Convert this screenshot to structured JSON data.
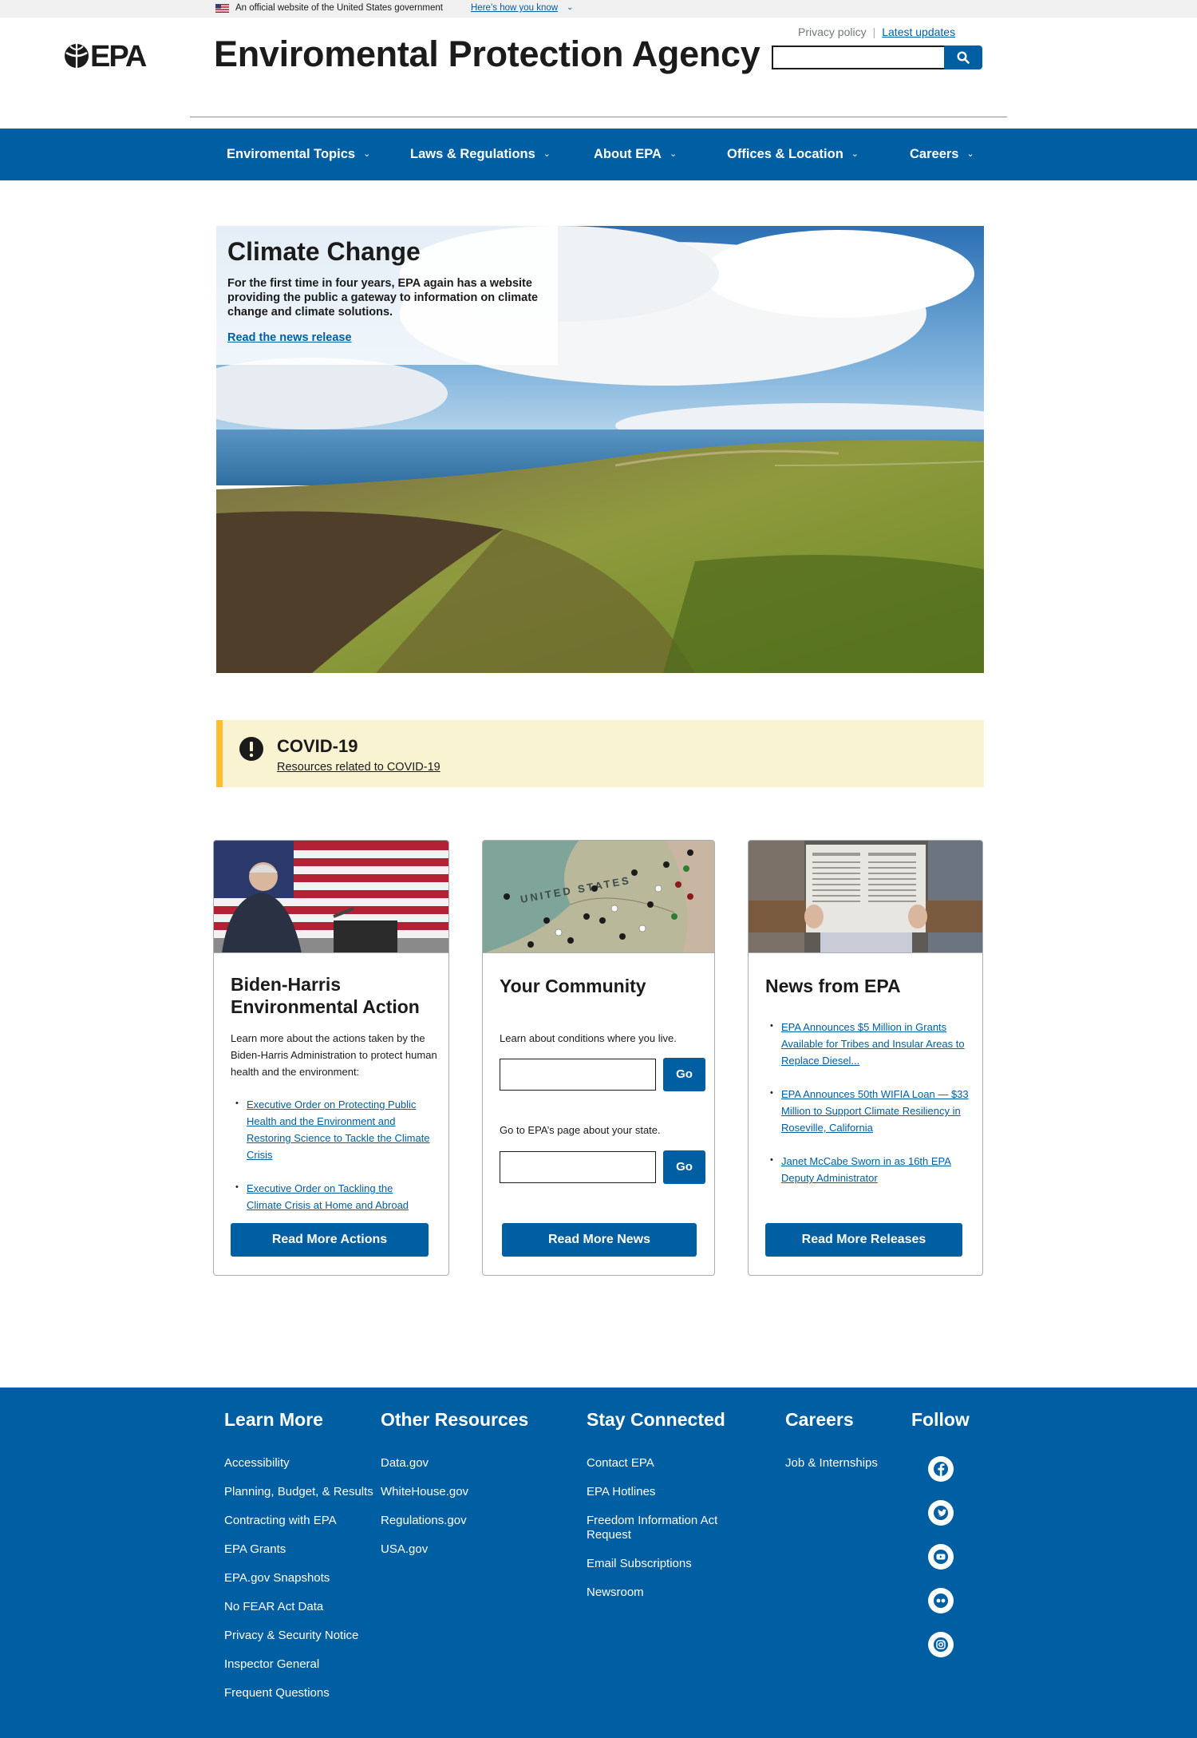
{
  "gov_banner": {
    "text": "An official website of the United States government",
    "link": "Here’s how you know"
  },
  "header": {
    "logo_text": "EPA",
    "title": "Enviromental Protection Agency",
    "privacy_link": "Privacy policy",
    "updates_link": "Latest updates",
    "search_placeholder": ""
  },
  "nav": {
    "items": [
      {
        "label": "Enviromental Topics"
      },
      {
        "label": "Laws & Regulations"
      },
      {
        "label": "About EPA"
      },
      {
        "label": "Offices & Location"
      },
      {
        "label": "Careers"
      }
    ]
  },
  "hero": {
    "title": "Climate Change",
    "description": "For the first time in four years, EPA again has a website providing the public a gateway to information on climate change and climate solutions.",
    "link": "Read the news release"
  },
  "alert": {
    "title": "COVID-19",
    "link": "Resources related to COVID-19"
  },
  "cards": {
    "actions": {
      "title": "Biden-Harris Environmental Action",
      "intro": "Learn more about the actions taken by the Biden-Harris Administration to protect human health and the environment:",
      "links": [
        "Executive Order on Protecting Public Health and the Environment and Restoring Science to Tackle the Climate Crisis",
        "Executive Order on Tackling the Climate Crisis at Home and Abroad"
      ],
      "button": "Read More Actions"
    },
    "community": {
      "title": "Your Community",
      "prompt1": "Learn about conditions where you live.",
      "prompt2": "Go to EPA’s page about your state.",
      "go_label": "Go",
      "map_label": "UNITED STATES",
      "button": "Read More News"
    },
    "news": {
      "title": "News from EPA",
      "links": [
        "EPA Announces $5 Million in Grants Available for Tribes and Insular Areas to Replace Diesel...",
        "EPA Announces 50th WIFIA Loan — $33 Million to Support Climate Resiliency in Roseville, California",
        "Janet McCabe Sworn in as 16th EPA Deputy Administrator"
      ],
      "button": "Read More Releases"
    }
  },
  "footer": {
    "learn_more": {
      "heading": "Learn More",
      "links": [
        "Accessibility",
        "Planning, Budget, & Results",
        "Contracting with EPA",
        "EPA Grants",
        "EPA.gov Snapshots",
        "No FEAR Act Data",
        "Privacy & Security Notice",
        "Inspector General",
        "Frequent Questions"
      ]
    },
    "other_resources": {
      "heading": "Other Resources",
      "links": [
        "Data.gov",
        "WhiteHouse.gov",
        "Regulations.gov",
        "USA.gov"
      ]
    },
    "stay_connected": {
      "heading": "Stay Connected",
      "links": [
        "Contact EPA",
        "EPA Hotlines",
        "Freedom Information Act Request",
        "Email Subscriptions",
        "Newsroom"
      ]
    },
    "careers": {
      "heading": "Careers",
      "links": [
        "Job & Internships"
      ]
    },
    "follow": {
      "heading": "Follow",
      "icons": [
        "facebook-icon",
        "twitter-icon",
        "youtube-icon",
        "flickr-icon",
        "instagram-icon"
      ]
    }
  },
  "colors": {
    "primary": "#005ea2",
    "alert_bg": "#faf3d1",
    "alert_border": "#ffbe2e",
    "gov_banner_bg": "#f0f0f0"
  }
}
